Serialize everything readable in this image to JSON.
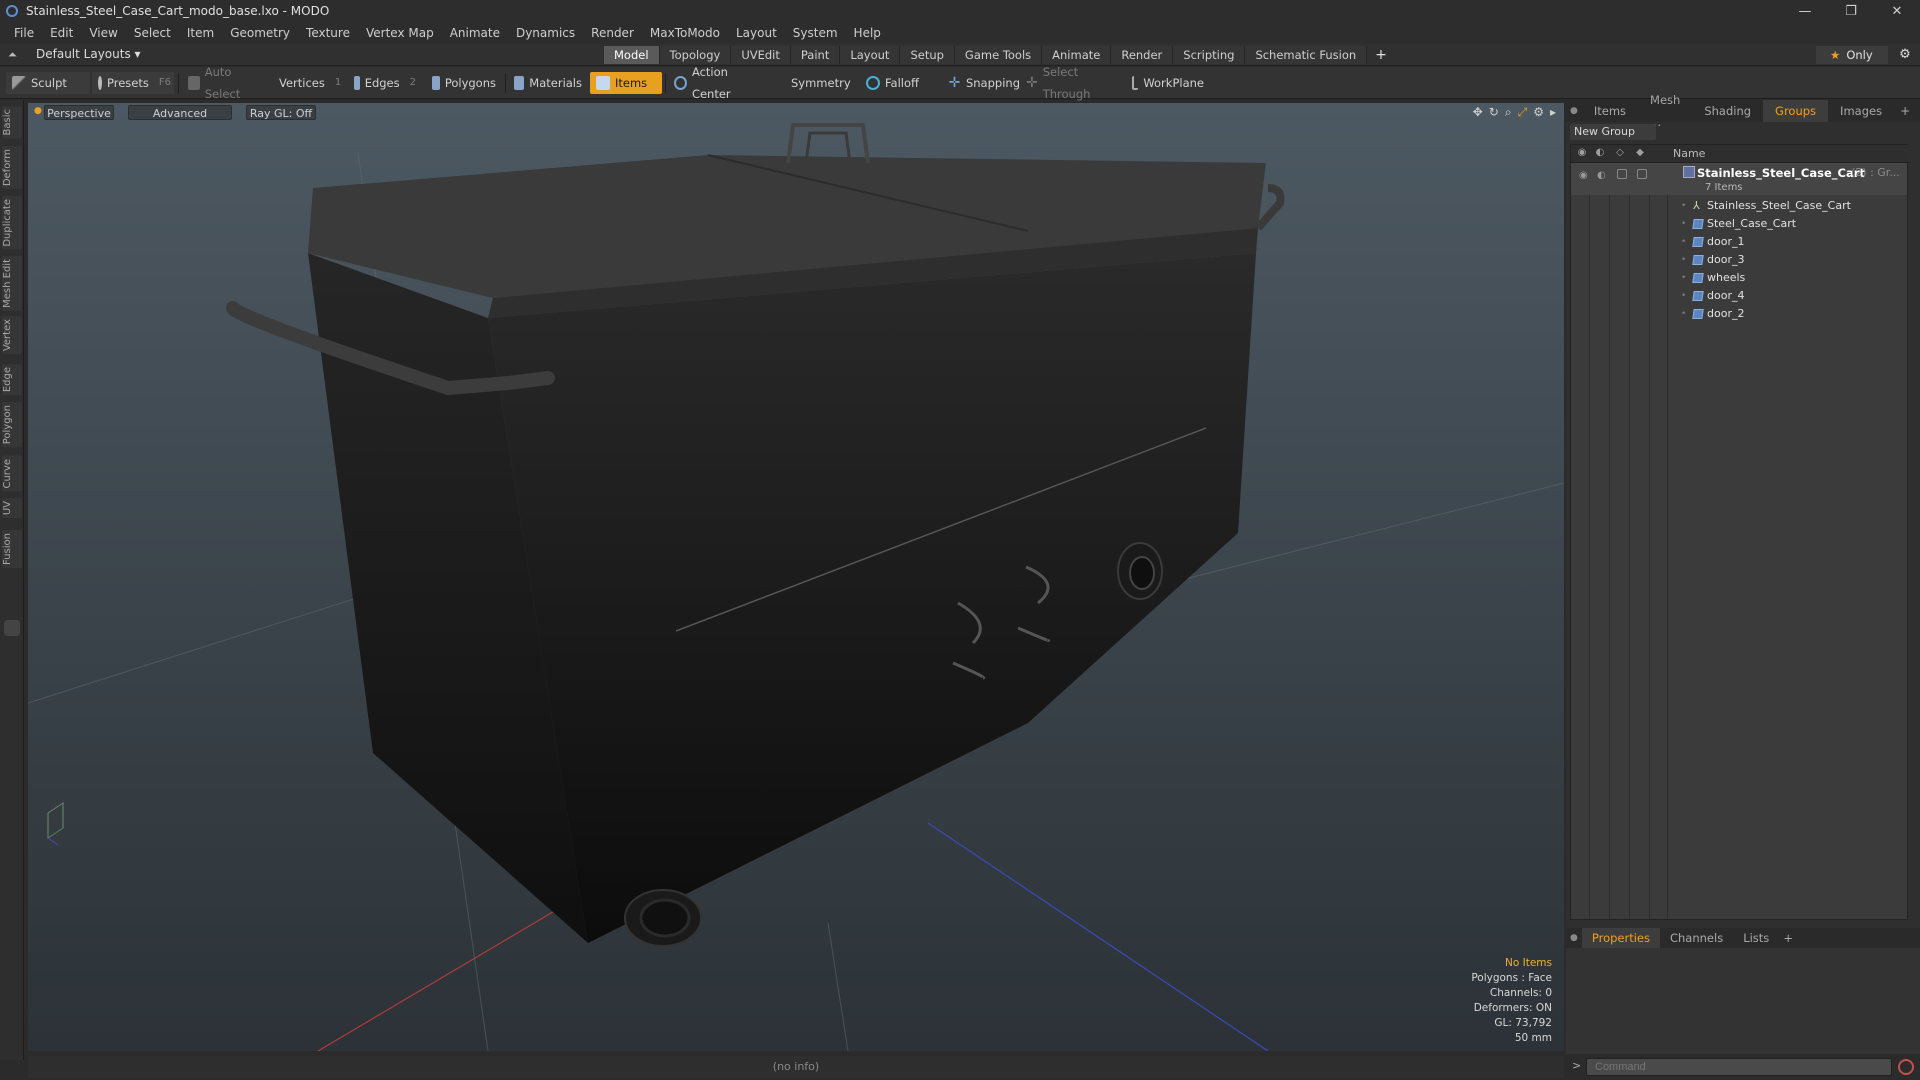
{
  "window": {
    "title": "Stainless_Steel_Case_Cart_modo_base.lxo - MODO",
    "controls": [
      "—",
      "❐",
      "✕"
    ]
  },
  "menu": [
    "File",
    "Edit",
    "View",
    "Select",
    "Item",
    "Geometry",
    "Texture",
    "Vertex Map",
    "Animate",
    "Dynamics",
    "Render",
    "MaxToModo",
    "Layout",
    "System",
    "Help"
  ],
  "layoutbar": {
    "layout_name": "Default Layouts ▾",
    "tabs": [
      "Model",
      "Topology",
      "UVEdit",
      "Paint",
      "Layout",
      "Setup",
      "Game Tools",
      "Animate",
      "Render",
      "Scripting",
      "Schematic Fusion"
    ],
    "active_tab": "Model",
    "plus": "+",
    "only_label": "Only"
  },
  "toolbar": {
    "sculpt": "Sculpt",
    "presets": "Presets",
    "presets_key": "F6",
    "auto_select": "Auto Select",
    "vertices": "Vertices",
    "vertices_num": "1",
    "edges": "Edges",
    "edges_num": "2",
    "polygons": "Polygons",
    "materials": "Materials",
    "items": "Items",
    "action_center": "Action Center",
    "symmetry": "Symmetry",
    "falloff": "Falloff",
    "snapping": "Snapping",
    "select_through": "Select Through",
    "workplane": "WorkPlane"
  },
  "left_tabs": [
    "Basic",
    "Deform",
    "Duplicate",
    "Mesh Edit",
    "Vertex",
    "Edge",
    "Polygon",
    "Curve",
    "UV",
    "Fusion"
  ],
  "viewport": {
    "view_mode": "Perspective",
    "shading": "Advanced",
    "raygl": "Ray GL: Off",
    "info": {
      "selection": "No Items",
      "polygons": "Polygons : Face",
      "channels": "Channels: 0",
      "deformers": "Deformers: ON",
      "gl": "GL: 73,792",
      "scale": "50 mm"
    },
    "status": "(no info)"
  },
  "right_panel": {
    "tabs": [
      "Items",
      "Mesh ...",
      "Shading",
      "Groups",
      "Images"
    ],
    "active_tab": "Groups",
    "new_group": "New Group",
    "column_name": "Name",
    "group": {
      "name": "Stainless_Steel_Case_Cart",
      "suffix": "(2) : Gr...",
      "count": "7 Items"
    },
    "children": [
      {
        "label": "Stainless_Steel_Case_Cart",
        "type": "locator"
      },
      {
        "label": "Steel_Case_Cart",
        "type": "mesh"
      },
      {
        "label": "door_1",
        "type": "mesh"
      },
      {
        "label": "door_3",
        "type": "mesh"
      },
      {
        "label": "wheels",
        "type": "mesh"
      },
      {
        "label": "door_4",
        "type": "mesh"
      },
      {
        "label": "door_2",
        "type": "mesh"
      }
    ],
    "bottom_tabs": [
      "Properties",
      "Channels",
      "Lists"
    ],
    "bottom_active": "Properties",
    "command_placeholder": "Command"
  },
  "colors": {
    "accent": "#e8a020",
    "viewport_top": "#4c5861",
    "viewport_bottom": "#2c3237"
  }
}
